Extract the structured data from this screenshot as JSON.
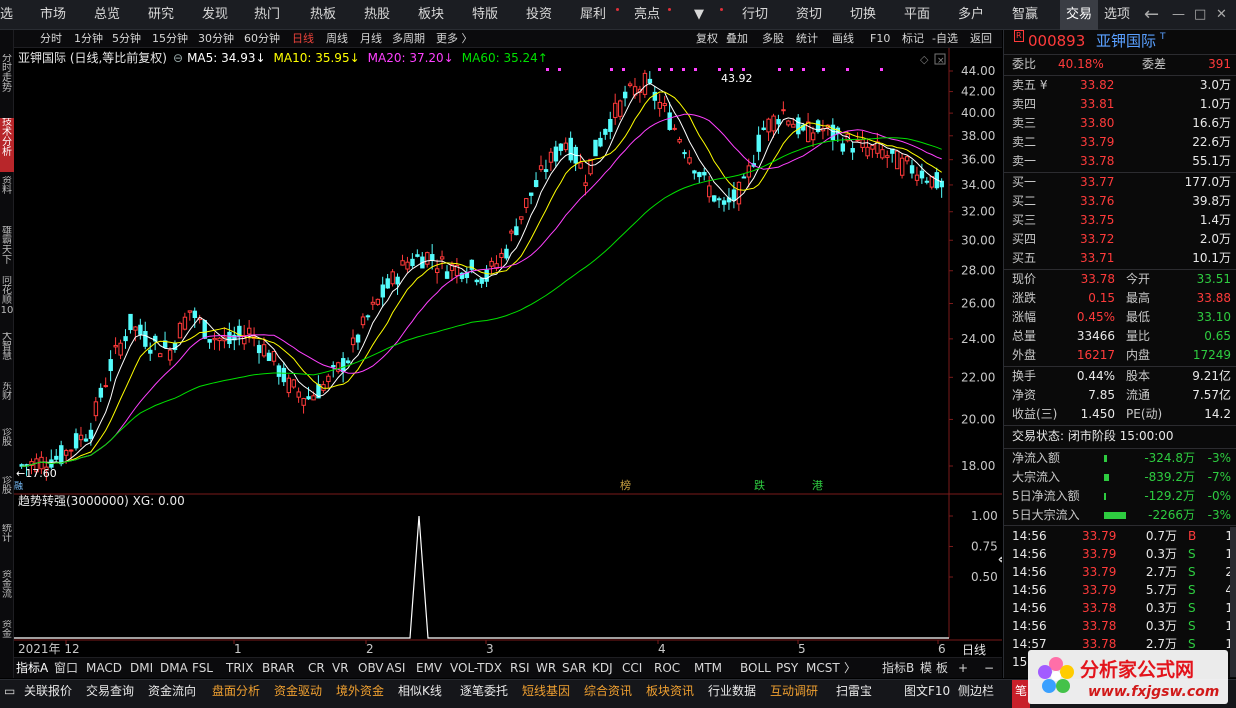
{
  "topnav": {
    "items": [
      "选",
      "市场",
      "总览",
      "研究",
      "发现",
      "热门",
      "热板",
      "热股",
      "板块",
      "特版",
      "投资",
      "犀利",
      "亮点",
      "▼",
      "行切",
      "资切",
      "切换",
      "平面",
      "多户",
      "智赢",
      "交易",
      "选项"
    ],
    "active_index": 20,
    "back_icon": "back-arrow-icon"
  },
  "periods": [
    "分时",
    "1分钟",
    "5分钟",
    "15分钟",
    "30分钟",
    "60分钟",
    "日线",
    "周线",
    "月线",
    "多周期",
    "更多 〉"
  ],
  "active_period": "日线",
  "toolbar": [
    "复权",
    "叠加",
    "多股",
    "统计",
    "画线",
    "F10",
    "标记",
    "-自选",
    "返回"
  ],
  "left_tabs": [
    "分时走势",
    "技术分析",
    "资料",
    "雄霸天下",
    "同花顺10",
    "大智慧",
    "东财",
    "诊股",
    "诊股",
    "统计",
    "资金流",
    "资金"
  ],
  "left_active": 1,
  "main": {
    "title": "亚钾国际 (日线,等比前复权)",
    "ma5": "MA5: 34.93↓",
    "ma10": "MA10: 35.95↓",
    "ma20": "MA20: 37.20↓",
    "ma60": "MA60: 35.24↑",
    "max_label": "43.92",
    "min_label": "←17.60",
    "markers": [
      "榜",
      "跌",
      "港"
    ],
    "mark_left": "融"
  },
  "sub": {
    "title": "趋势转强(3000000)  XG: 0.00"
  },
  "x_labels": [
    "2021年 12",
    "1",
    "2",
    "3",
    "4",
    "5",
    "6"
  ],
  "y_main": [
    "44.00",
    "42.00",
    "40.00",
    "38.00",
    "36.00",
    "34.00",
    "32.00",
    "30.00",
    "28.00",
    "26.00",
    "24.00",
    "22.00",
    "20.00",
    "18.00"
  ],
  "y_sub": [
    "1.00",
    "0.75",
    "0.50"
  ],
  "period_corner": "日线",
  "chart_data": {
    "type": "candlestick",
    "min": 17.6,
    "max": 43.92,
    "last": 33.78,
    "series": [
      "MA5",
      "MA10",
      "MA20",
      "MA60"
    ],
    "indicator_peak": 1.0
  },
  "quote": {
    "badge": "R",
    "code": "000893",
    "name": "亚钾国际",
    "name_sup": "T",
    "weibi_label": "委比",
    "weibi": "40.18%",
    "weicha_label": "委差",
    "weicha": "391",
    "sell": [
      {
        "label": "卖五 ¥",
        "price": "33.82",
        "vol": "3.0万"
      },
      {
        "label": "卖四",
        "price": "33.81",
        "vol": "1.0万"
      },
      {
        "label": "卖三",
        "price": "33.80",
        "vol": "16.6万"
      },
      {
        "label": "卖二",
        "price": "33.79",
        "vol": "22.6万"
      },
      {
        "label": "卖一",
        "price": "33.78",
        "vol": "55.1万"
      }
    ],
    "buy": [
      {
        "label": "买一",
        "price": "33.77",
        "vol": "177.0万"
      },
      {
        "label": "买二",
        "price": "33.76",
        "vol": "39.8万"
      },
      {
        "label": "买三",
        "price": "33.75",
        "vol": "1.4万"
      },
      {
        "label": "买四",
        "price": "33.72",
        "vol": "2.0万"
      },
      {
        "label": "买五",
        "price": "33.71",
        "vol": "10.1万"
      }
    ],
    "stats": [
      {
        "l1": "现价",
        "v1": "33.78",
        "c1": "#ff3b3b",
        "l2": "今开",
        "v2": "33.51",
        "c2": "#2ecc40"
      },
      {
        "l1": "涨跌",
        "v1": "0.15",
        "c1": "#ff3b3b",
        "l2": "最高",
        "v2": "33.88",
        "c2": "#ff3b3b"
      },
      {
        "l1": "涨幅",
        "v1": "0.45%",
        "c1": "#ff3b3b",
        "l2": "最低",
        "v2": "33.10",
        "c2": "#2ecc40"
      },
      {
        "l1": "总量",
        "v1": "33466",
        "c1": "#e8e8e8",
        "l2": "量比",
        "v2": "0.65",
        "c2": "#2ecc40"
      },
      {
        "l1": "外盘",
        "v1": "16217",
        "c1": "#ff3b3b",
        "l2": "内盘",
        "v2": "17249",
        "c2": "#2ecc40"
      }
    ],
    "stats2": [
      {
        "l1": "换手",
        "v1": "0.44%",
        "l2": "股本",
        "v2": "9.21亿"
      },
      {
        "l1": "净资",
        "v1": "7.85",
        "l2": "流通",
        "v2": "7.57亿"
      },
      {
        "l1": "收益(三)",
        "v1": "1.450",
        "l2": "PE(动)",
        "v2": "14.2"
      }
    ],
    "state": "交易状态: 闭市阶段 15:00:00",
    "flows": [
      {
        "label": "净流入额",
        "val": "-324.8万",
        "pct": "-3%",
        "bar": 3
      },
      {
        "label": "大宗流入",
        "val": "-839.2万",
        "pct": "-7%",
        "bar": 5
      },
      {
        "label": "5日净流入额",
        "val": "-129.2万",
        "pct": "-0%",
        "bar": 2
      },
      {
        "label": "5日大宗流入",
        "val": "-2266万",
        "pct": "-3%",
        "bar": 22
      }
    ],
    "ticks": [
      {
        "t": "14:56",
        "p": "33.79",
        "v": "0.7万",
        "s": "B",
        "n": "1"
      },
      {
        "t": "14:56",
        "p": "33.79",
        "v": "0.3万",
        "s": "S",
        "n": "1"
      },
      {
        "t": "14:56",
        "p": "33.79",
        "v": "2.7万",
        "s": "S",
        "n": "2"
      },
      {
        "t": "14:56",
        "p": "33.79",
        "v": "5.7万",
        "s": "S",
        "n": "4"
      },
      {
        "t": "14:56",
        "p": "33.78",
        "v": "0.3万",
        "s": "S",
        "n": "1"
      },
      {
        "t": "14:56",
        "p": "33.78",
        "v": "0.3万",
        "s": "S",
        "n": "1"
      },
      {
        "t": "14:57",
        "p": "33.78",
        "v": "2.7万",
        "s": "S",
        "n": "1"
      },
      {
        "t": "15",
        "p": "",
        "v": "",
        "s": "",
        "n": ""
      }
    ]
  },
  "indicators": [
    "指标A",
    "窗口",
    "MACD",
    "DMI",
    "DMA",
    "FSL",
    "TRIX",
    "BRAR",
    "CR",
    "VR",
    "OBV",
    "ASI",
    "EMV",
    "VOL-TDX",
    "RSI",
    "WR",
    "SAR",
    "KDJ",
    "CCI",
    "ROC",
    "MTM",
    "BOLL",
    "PSY",
    "MCST",
    "〉"
  ],
  "indicators_right": [
    "指标B",
    "模",
    "板",
    "+",
    "−"
  ],
  "bottom": [
    "关联报价",
    "交易查询",
    "资金流向",
    "盘面分析",
    "资金驱动",
    "境外资金",
    "相似K线",
    "逐笔委托",
    "短线基因",
    "综合资讯",
    "板块资讯",
    "行业数据",
    "互动调研",
    "扫雷宝",
    "图文F10",
    "侧边栏",
    "笔"
  ],
  "logo": {
    "text": "分析家公式网",
    "url": "www.fxjgsw.com"
  }
}
